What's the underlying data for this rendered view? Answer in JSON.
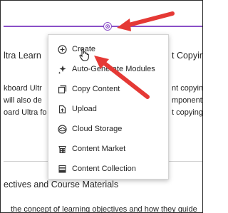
{
  "background": {
    "title": "ltra Learn",
    "title_right": "t Copying",
    "line_left_1": "kboard Ultr",
    "line_left_2": "will also de",
    "line_left_3": "oard Ultra fo",
    "line_right_1": "nt copying.",
    "line_right_2": "mponents w",
    "line_right_3": "t copying.",
    "section_heading": "ectives and Course Materials",
    "bottom_text": "the concept of learning objectives and how they guide"
  },
  "divider": {
    "button_glyph": "⊗"
  },
  "menu": {
    "items": [
      {
        "label": "Create",
        "icon": "plus-circle-icon"
      },
      {
        "label": "Auto-Generate Modules",
        "icon": "sparkle-icon"
      },
      {
        "label": "Copy Content",
        "icon": "copy-icon"
      },
      {
        "label": "Upload",
        "icon": "upload-icon"
      },
      {
        "label": "Cloud Storage",
        "icon": "cloud-icon"
      },
      {
        "label": "Content Market",
        "icon": "market-icon"
      },
      {
        "label": "Content Collection",
        "icon": "collection-icon"
      }
    ]
  },
  "colors": {
    "accent": "#8a4fc7",
    "arrow": "#e53935"
  }
}
